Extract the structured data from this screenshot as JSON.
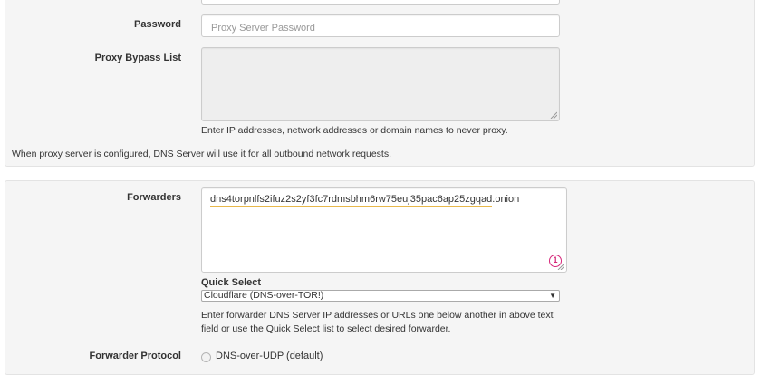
{
  "proxy": {
    "password_label": "Password",
    "password_placeholder": "Proxy Server Password",
    "bypass_label": "Proxy Bypass List",
    "bypass_help": "Enter IP addresses, network addresses or domain names to never proxy.",
    "footer_note": "When proxy server is configured, DNS Server will use it for all outbound network requests."
  },
  "forwarders": {
    "label": "Forwarders",
    "value": "dns4torpnlfs2ifuz2s2yf3fc7rdmsbhm6rw75euj35pac6ap25zgqad",
    "value_suffix": ".onion",
    "badge_count": "1",
    "quick_select_title": "Quick Select",
    "quick_select_value": "Cloudflare (DNS-over-TOR!)",
    "help_line1": "Enter forwarder DNS Server IP addresses or URLs one below another in above text",
    "help_line2": "field or use the Quick Select list to select desired forwarder.",
    "protocol_label": "Forwarder Protocol",
    "protocol_option_udp": "DNS-over-UDP (default)"
  },
  "colors": {
    "panel_bg": "#f5f5f5",
    "badge": "#d6287a",
    "spell_underline": "#e8b84a"
  }
}
